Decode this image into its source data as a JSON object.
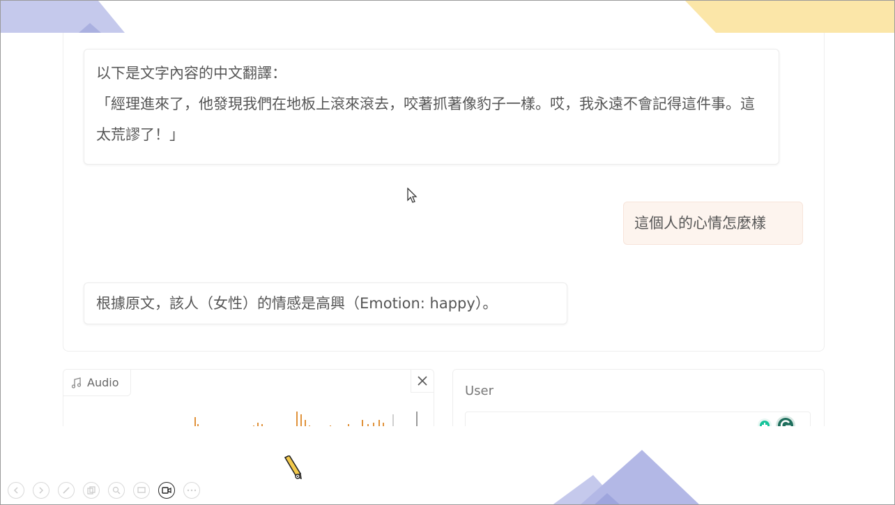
{
  "chat": {
    "bot_message_1_intro": "以下是文字內容的中文翻譯：",
    "bot_message_1_body": "「經理進來了，他發現我們在地板上滾來滾去，咬著抓著像豹子一樣。哎，我永遠不會記得這件事。這太荒謬了！」",
    "user_message_1": "這個人的心情怎麼樣",
    "bot_message_2": "根據原文，該人（女性）的情感是高興（Emotion: happy）。"
  },
  "audio": {
    "label": "Audio",
    "music_icon": "music-note-icon",
    "close_icon": "close-icon"
  },
  "user_input": {
    "label": "User",
    "value": ""
  },
  "toolbar": {
    "icons": [
      "prev-icon",
      "next-icon",
      "pen-icon",
      "copy-icon",
      "zoom-icon",
      "screen-icon",
      "video-icon",
      "more-icon"
    ]
  },
  "colors": {
    "user_bubble_bg": "#fdf4ee",
    "deco_blue": "#c5c9ec",
    "deco_yellow": "#fbe6a8",
    "waveform": "#e0923a",
    "grammarly_green": "#15c39a"
  }
}
